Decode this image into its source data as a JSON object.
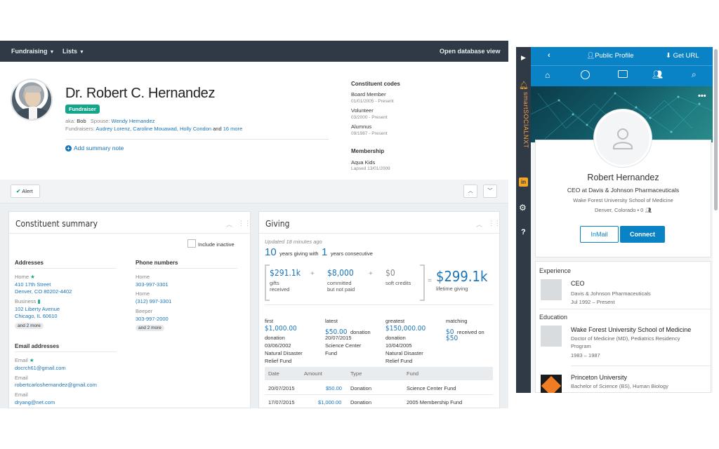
{
  "nav": {
    "fundraising": "Fundraising",
    "lists": "Lists",
    "open_db_view": "Open database view"
  },
  "profile": {
    "name": "Dr. Robert C. Hernandez",
    "badge": "Fundraiser",
    "aka_label": "aka:",
    "aka": "Bob",
    "spouse_label": "Spouse:",
    "spouse": "Wendy Hernandez",
    "fundraisers_label": "Fundraisers:",
    "fundraisers": "Audrey Lorenz, Caroline Mouawad, Holly Condon",
    "and": "and",
    "more": "16 more",
    "add_note": "Add summary note"
  },
  "codes": {
    "title": "Constituent codes",
    "items": [
      {
        "name": "Board Member",
        "date": "01/01/2005 - Present"
      },
      {
        "name": "Volunteer",
        "date": "03/2000 - Present"
      },
      {
        "name": "Alumnus",
        "date": "09/1987 - Present"
      }
    ],
    "membership_title": "Membership",
    "membership_name": "Aqua Kids",
    "membership_date": "Lapsed 13/01/2009"
  },
  "alert_label": "Alert",
  "summary": {
    "title": "Constituent summary",
    "include_inactive": "Include inactive",
    "addresses_title": "Addresses",
    "home_label": "Home",
    "home_line1": "410 17th Street",
    "home_line2": "Denver, CO 80202-4402",
    "business_label": "Business",
    "business_line1": "102 Liberty Avenue",
    "business_line2": "Chicago, IL 60610",
    "addr_more": "and 2 more",
    "phones_title": "Phone numbers",
    "phone_home_label": "Home",
    "phone_home1": "303-997-3301",
    "phone_home2_label": "Home",
    "phone_home2": "(312) 997-3301",
    "beeper_label": "Beeper",
    "beeper": "303-997-2000",
    "phone_more": "and 2 more",
    "email_title": "Email addresses",
    "email_label": "Email",
    "email1": "docrch61@gmail.com",
    "email2_label": "Email",
    "email2": "robertcarloshernandez@gmail.com",
    "email3_label": "Email",
    "email3": "dryang@net.com"
  },
  "giving": {
    "title": "Giving",
    "updated": "Updated 18 minutes ago",
    "years": "10",
    "years_text": "years giving with",
    "consec": "1",
    "consec_text": "years consecutive",
    "gifts_amt": "$291.1k",
    "gifts_desc1": "gifts",
    "gifts_desc2": "received",
    "committed_amt": "$8,000",
    "committed_desc1": "committed",
    "committed_desc2": "but not paid",
    "soft_amt": "$0",
    "soft_desc": "soft credits",
    "total_amt": "$299.1k",
    "total_desc": "lifetime giving",
    "first_label": "first",
    "first_amt": "$1,000.00",
    "first_type": "donation",
    "first_date": "03/06/2002",
    "first_fund1": "Natural Disaster",
    "first_fund2": "Relief Fund",
    "latest_label": "latest",
    "latest_amt": "$50.00",
    "latest_type": "donation",
    "latest_date": "20/07/2015",
    "latest_fund1": "Science Center",
    "latest_fund2": "Fund",
    "greatest_label": "greatest",
    "greatest_amt": "$150,000.00",
    "greatest_type": "donation",
    "greatest_date": "10/04/2005",
    "greatest_fund1": "Natural Disaster",
    "greatest_fund2": "Relief Fund",
    "matching_label": "matching",
    "matching_amt1": "$0",
    "matching_txt": "received on",
    "matching_amt2": "$50",
    "table_headers": [
      "Date",
      "Amount",
      "Type",
      "Fund"
    ],
    "rows": [
      {
        "date": "20/07/2015",
        "amount": "$50.00",
        "type": "Donation",
        "fund": "Science Center Fund"
      },
      {
        "date": "17/07/2015",
        "amount": "$1,000.00",
        "type": "Donation",
        "fund": "2005 Membership Fund"
      }
    ]
  },
  "social": {
    "public_profile": "Public Profile",
    "get_url": "Get URL",
    "brand": "smartSOCIALNXT",
    "name": "Robert Hernandez",
    "headline": "CEO at Davis & Johnson Pharmaceuticals",
    "school": "Wake Forest University School of Medicine",
    "location": "Denver, Colorado • 0",
    "inmail": "InMail",
    "connect": "Connect",
    "experience_title": "Experience",
    "exp_role": "CEO",
    "exp_company": "Davis & Johnson Pharmaceuticals",
    "exp_dates": "Jul 1992 – Present",
    "education_title": "Education",
    "edu1_school": "Wake Forest University School of Medicine",
    "edu1_degree": "Doctor of Medicine (MD), Pediatrics Residency",
    "edu1_degree2": "Program",
    "edu1_dates": "1983 – 1987",
    "edu2_school": "Princeton University",
    "edu2_degree": "Bachelor of Science (BS), Human Biology"
  },
  "colors": {
    "accent": "#1a74b8",
    "badge": "#14a68a",
    "nav": "#2f3a46",
    "social_blue": "#0a83c6"
  }
}
